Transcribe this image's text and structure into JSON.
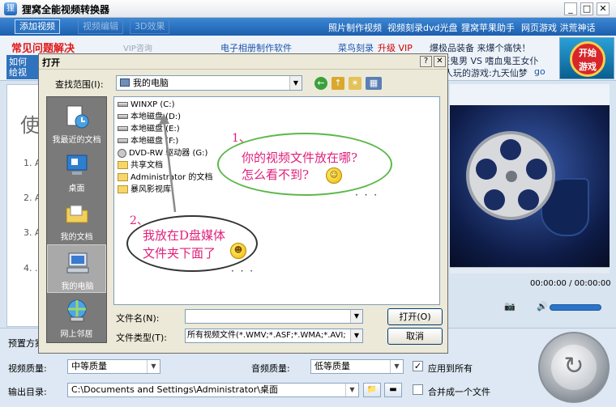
{
  "app": {
    "title": "狸窝全能视频转换器",
    "logo_glyph": "狸"
  },
  "window_controls": {
    "minimize": "_",
    "maximize": "□",
    "close": "✕"
  },
  "menubar": {
    "tabs": [
      "添加视频",
      "视频编辑",
      "3D效果"
    ],
    "links": [
      "照片制作视频",
      "视频刻录dvd光盘",
      "狸窝苹果助手",
      "网页游戏 洪荒神话"
    ]
  },
  "adbar": {
    "faq": "常见问题解决",
    "vip_consult": "VIP咨询",
    "ad1": "电子相册制作软件",
    "ad2a": "菜鸟刻录",
    "ad2b": "升级 VIP",
    "ad3a": "爆极品装备 来爆个痛快！",
    "ad3b": "狂鬼男 VS 嗜血鬼王女仆",
    "ad3c": "人玩的游戏:九天仙梦",
    "ad3c_go": "go",
    "left_links": [
      "如何",
      "给视"
    ],
    "game_btn_line1": "开始",
    "game_btn_line2": "游戏"
  },
  "main": {
    "big_char": "使",
    "steps": [
      "1. A",
      "2. A",
      "3. A",
      "4. ."
    ]
  },
  "player": {
    "time": "00:00:00 / 00:00:00",
    "camera_icon": "📷",
    "speaker_icon": "🔊"
  },
  "bottom": {
    "preset_label": "预置方案",
    "video_quality_label": "视频质量:",
    "video_quality_value": "中等质量",
    "audio_quality_label": "音频质量:",
    "audio_quality_value": "低等质量",
    "apply_all_label": "应用到所有",
    "apply_all_checked": true,
    "output_label": "输出目录:",
    "output_value": "C:\\Documents and Settings\\Administrator\\桌面",
    "merge_label": "合并成一个文件",
    "merge_checked": false
  },
  "dialog": {
    "title": "打开",
    "help_btn": "?",
    "close_btn": "✕",
    "lookin_label": "查找范围(I):",
    "lookin_value": "我的电脑",
    "places": [
      {
        "label": "我最近的文档"
      },
      {
        "label": "桌面"
      },
      {
        "label": "我的文档"
      },
      {
        "label": "我的电脑"
      },
      {
        "label": "网上邻居"
      }
    ],
    "selected_place": "我的电脑",
    "files": [
      {
        "name": "WINXP (C:)",
        "type": "drive"
      },
      {
        "name": "本地磁盘 (D:)",
        "type": "drive"
      },
      {
        "name": "本地磁盘 (E:)",
        "type": "drive"
      },
      {
        "name": "本地磁盘 (F:)",
        "type": "drive"
      },
      {
        "name": "DVD-RW 驱动器 (G:)",
        "type": "dvd"
      },
      {
        "name": "共享文档",
        "type": "folder"
      },
      {
        "name": "Administrator 的文档",
        "type": "folder"
      },
      {
        "name": "暴风影视库",
        "type": "folder"
      }
    ],
    "filename_label": "文件名(N):",
    "filename_value": "",
    "filetype_label": "文件类型(T):",
    "filetype_value": "所有视频文件(*.WMV;*.ASF;*.WMA;*.AVI;",
    "open_btn": "打开(O)",
    "cancel_btn": "取消"
  },
  "annotations": {
    "note1_num": "1、",
    "note1_text_line1": "你的视频文件放在哪?",
    "note1_text_line2": "怎么看不到?",
    "note2_num": "2、",
    "note2_text_line1": "我放在D盘媒体",
    "note2_text_line2": "文件夹下面了",
    "dots1": "· · ·",
    "dots2": "· · ·"
  },
  "colors": {
    "accent_blue": "#1c5fae",
    "annotation_pink": "#e0207a",
    "bubble1_border": "#5cb84a",
    "bubble2_border": "#333333"
  }
}
